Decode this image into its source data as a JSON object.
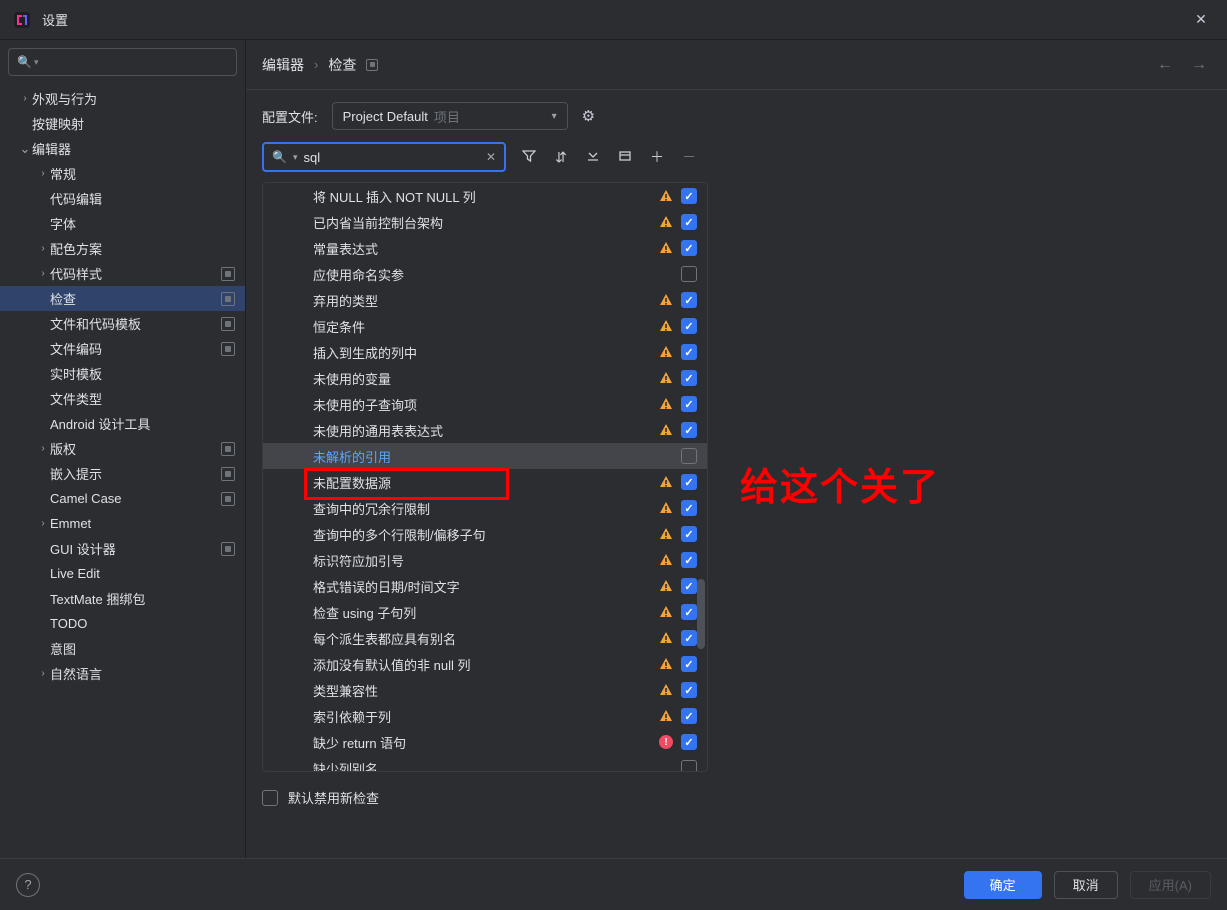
{
  "window": {
    "title": "设置",
    "close_alt": "Close"
  },
  "sidebar": {
    "search_placeholder": "",
    "items": [
      {
        "label": "外观与行为",
        "depth": 0,
        "chev": "right",
        "badge": false
      },
      {
        "label": "按键映射",
        "depth": 0,
        "chev": "",
        "badge": false
      },
      {
        "label": "编辑器",
        "depth": 0,
        "chev": "down",
        "badge": false
      },
      {
        "label": "常规",
        "depth": 1,
        "chev": "right",
        "badge": false
      },
      {
        "label": "代码编辑",
        "depth": 1,
        "chev": "",
        "badge": false
      },
      {
        "label": "字体",
        "depth": 1,
        "chev": "",
        "badge": false
      },
      {
        "label": "配色方案",
        "depth": 1,
        "chev": "right",
        "badge": false
      },
      {
        "label": "代码样式",
        "depth": 1,
        "chev": "right",
        "badge": true
      },
      {
        "label": "检查",
        "depth": 1,
        "chev": "",
        "badge": true,
        "selected": true
      },
      {
        "label": "文件和代码模板",
        "depth": 1,
        "chev": "",
        "badge": true
      },
      {
        "label": "文件编码",
        "depth": 1,
        "chev": "",
        "badge": true
      },
      {
        "label": "实时模板",
        "depth": 1,
        "chev": "",
        "badge": false
      },
      {
        "label": "文件类型",
        "depth": 1,
        "chev": "",
        "badge": false
      },
      {
        "label": "Android 设计工具",
        "depth": 1,
        "chev": "",
        "badge": false
      },
      {
        "label": "版权",
        "depth": 1,
        "chev": "right",
        "badge": true
      },
      {
        "label": "嵌入提示",
        "depth": 1,
        "chev": "",
        "badge": true
      },
      {
        "label": "Camel Case",
        "depth": 1,
        "chev": "",
        "badge": true
      },
      {
        "label": "Emmet",
        "depth": 1,
        "chev": "right",
        "badge": false
      },
      {
        "label": "GUI 设计器",
        "depth": 1,
        "chev": "",
        "badge": true
      },
      {
        "label": "Live Edit",
        "depth": 1,
        "chev": "",
        "badge": false
      },
      {
        "label": "TextMate 捆绑包",
        "depth": 1,
        "chev": "",
        "badge": false
      },
      {
        "label": "TODO",
        "depth": 1,
        "chev": "",
        "badge": false
      },
      {
        "label": "意图",
        "depth": 1,
        "chev": "",
        "badge": false
      },
      {
        "label": "自然语言",
        "depth": 1,
        "chev": "right",
        "badge": false
      }
    ]
  },
  "breadcrumb": {
    "a": "编辑器",
    "b": "检查"
  },
  "profile": {
    "label": "配置文件:",
    "value": "Project Default",
    "suffix": "项目"
  },
  "search": {
    "value": "sql"
  },
  "inspections": [
    {
      "label": "将 NULL 插入 NOT NULL 列",
      "icon": "warn",
      "checked": true
    },
    {
      "label": "已内省当前控制台架构",
      "icon": "warn",
      "checked": true
    },
    {
      "label": "常量表达式",
      "icon": "warn",
      "checked": true
    },
    {
      "label": "应使用命名实参",
      "icon": "",
      "checked": false
    },
    {
      "label": "弃用的类型",
      "icon": "warn",
      "checked": true
    },
    {
      "label": "恒定条件",
      "icon": "warn",
      "checked": true
    },
    {
      "label": "插入到生成的列中",
      "icon": "warn",
      "checked": true
    },
    {
      "label": "未使用的变量",
      "icon": "warn",
      "checked": true
    },
    {
      "label": "未使用的子查询项",
      "icon": "warn",
      "checked": true
    },
    {
      "label": "未使用的通用表表达式",
      "icon": "warn",
      "checked": true
    },
    {
      "label": "未解析的引用",
      "icon": "",
      "checked": false,
      "selected": true
    },
    {
      "label": "未配置数据源",
      "icon": "warn",
      "checked": true
    },
    {
      "label": "查询中的冗余行限制",
      "icon": "warn",
      "checked": true
    },
    {
      "label": "查询中的多个行限制/偏移子句",
      "icon": "warn",
      "checked": true
    },
    {
      "label": "标识符应加引号",
      "icon": "warn",
      "checked": true
    },
    {
      "label": "格式错误的日期/时间文字",
      "icon": "warn",
      "checked": true
    },
    {
      "label": "检查 using 子句列",
      "icon": "warn",
      "checked": true
    },
    {
      "label": "每个派生表都应具有别名",
      "icon": "warn",
      "checked": true
    },
    {
      "label": "添加没有默认值的非 null 列",
      "icon": "warn",
      "checked": true
    },
    {
      "label": "类型兼容性",
      "icon": "warn",
      "checked": true
    },
    {
      "label": "索引依赖于列",
      "icon": "warn",
      "checked": true
    },
    {
      "label": "缺少 return 语句",
      "icon": "err",
      "checked": true
    },
    {
      "label": "缺少列别名",
      "icon": "",
      "checked": false
    }
  ],
  "disable_new": "默认禁用新检查",
  "annotation": "给这个关了",
  "footer": {
    "ok": "确定",
    "cancel": "取消",
    "apply": "应用(A)"
  }
}
